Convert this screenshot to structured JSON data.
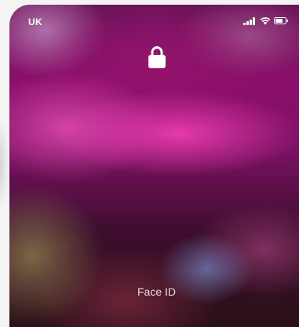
{
  "status_bar": {
    "carrier": "UK",
    "icons": [
      "cellular-signal-icon",
      "wifi-icon",
      "battery-icon"
    ]
  },
  "lock_screen": {
    "lock_icon": "lock-icon",
    "face_id_label": "Face ID"
  },
  "colors": {
    "text": "#ffffff",
    "wallpaper_primary": "#8c0f6b",
    "wallpaper_accent": "#eb3caf"
  }
}
